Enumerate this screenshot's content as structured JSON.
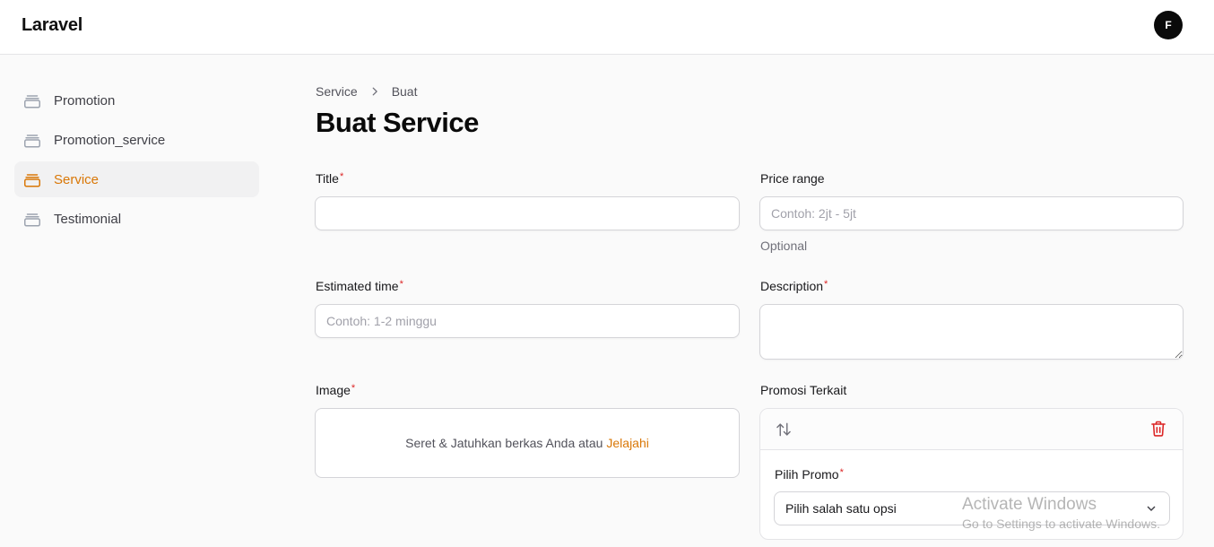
{
  "app": {
    "brand": "Laravel",
    "user_initial": "F"
  },
  "sidebar": {
    "items": [
      {
        "label": "Promotion",
        "icon": "rectangle-stack-icon",
        "active": false
      },
      {
        "label": "Promotion_service",
        "icon": "rectangle-stack-icon",
        "active": false
      },
      {
        "label": "Service",
        "icon": "rectangle-stack-icon",
        "active": true
      },
      {
        "label": "Testimonial",
        "icon": "rectangle-stack-icon",
        "active": false
      }
    ]
  },
  "breadcrumb": {
    "parent": "Service",
    "current": "Buat"
  },
  "page": {
    "title": "Buat Service"
  },
  "form": {
    "title": {
      "label": "Title",
      "value": "",
      "placeholder": ""
    },
    "price_range": {
      "label": "Price range",
      "placeholder": "Contoh: 2jt - 5jt",
      "help": "Optional"
    },
    "estimated_time": {
      "label": "Estimated time",
      "placeholder": "Contoh: 1-2 minggu"
    },
    "description": {
      "label": "Description",
      "value": ""
    },
    "image": {
      "label": "Image",
      "drop_text": "Seret & Jatuhkan berkas Anda atau",
      "browse_text": "Jelajahi"
    },
    "promosi": {
      "label": "Promosi Terkait",
      "item_label": "Pilih Promo",
      "select_value": "Pilih salah satu opsi"
    }
  },
  "required_marker": "*",
  "colors": {
    "accent": "#d97706",
    "danger": "#dc2626"
  },
  "watermark": {
    "line1": "Activate Windows",
    "line2": "Go to Settings to activate Windows."
  }
}
